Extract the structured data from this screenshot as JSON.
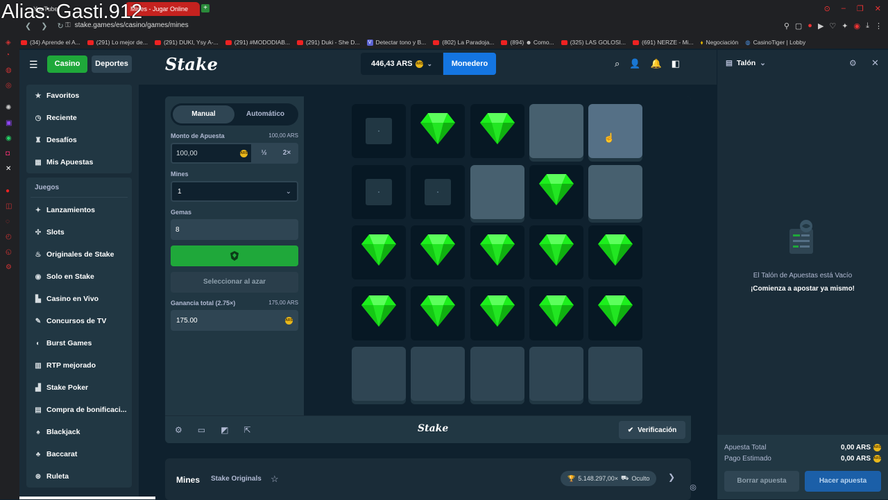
{
  "overlay": {
    "watermark": "Alias: Gasti.912"
  },
  "browser": {
    "tabs": [
      {
        "label": "YouTube"
      },
      {
        "label": "Mines - Jugar Online"
      }
    ],
    "url": "stake.games/es/casino/games/mines",
    "bookmarks": [
      {
        "label": "(34) Aprende el A...",
        "icon": "youtube-icon"
      },
      {
        "label": "(291) Lo mejor de...",
        "icon": "youtube-icon"
      },
      {
        "label": "(291) DUKI, Ysy A-...",
        "icon": "youtube-icon"
      },
      {
        "label": "(291) #MODODIAB...",
        "icon": "youtube-icon"
      },
      {
        "label": "(291) Duki - She D...",
        "icon": "youtube-icon"
      },
      {
        "label": "Detectar tono y B...",
        "icon": "v-icon"
      },
      {
        "label": "(802) La Paradoja...",
        "icon": "youtube-icon"
      },
      {
        "label": "(894) ☻ Como...",
        "icon": "youtube-icon"
      },
      {
        "label": "(325) LAS GOLOSI...",
        "icon": "youtube-icon"
      },
      {
        "label": "(691) NERZE - Mi...",
        "icon": "youtube-icon"
      },
      {
        "label": "Negociación",
        "icon": "coin-icon"
      },
      {
        "label": "CasinoTiger | Lobby",
        "icon": "globe-icon"
      }
    ]
  },
  "header": {
    "casino_label": "Casino",
    "sports_label": "Deportes",
    "logo": "Stake",
    "balance": "446,43 ARS",
    "currency_badge": "ARS",
    "wallet_label": "Monedero"
  },
  "sidebar": {
    "top_items": [
      {
        "label": "Favoritos",
        "icon": "star-icon"
      },
      {
        "label": "Reciente",
        "icon": "clock-icon"
      },
      {
        "label": "Desafíos",
        "icon": "trophy-icon"
      },
      {
        "label": "Mis Apuestas",
        "icon": "list-icon"
      }
    ],
    "games_heading": "Juegos",
    "game_items": [
      {
        "label": "Lanzamientos",
        "icon": "sparkle-icon"
      },
      {
        "label": "Slots",
        "icon": "slots-icon"
      },
      {
        "label": "Originales de Stake",
        "icon": "fire-icon"
      },
      {
        "label": "Solo en Stake",
        "icon": "chip-icon"
      },
      {
        "label": "Casino en Vivo",
        "icon": "live-icon"
      },
      {
        "label": "Concursos de TV",
        "icon": "tv-icon"
      },
      {
        "label": "Burst Games",
        "icon": "burst-icon"
      },
      {
        "label": "RTP mejorado",
        "icon": "rtp-icon"
      },
      {
        "label": "Stake Poker",
        "icon": "poker-icon"
      },
      {
        "label": "Compra de bonificaci...",
        "icon": "gift-icon"
      },
      {
        "label": "Blackjack",
        "icon": "cards-icon"
      },
      {
        "label": "Baccarat",
        "icon": "baccarat-icon"
      },
      {
        "label": "Ruleta",
        "icon": "roulette-icon"
      }
    ]
  },
  "game": {
    "mode_manual": "Manual",
    "mode_auto": "Automático",
    "bet_label": "Monto de Apuesta",
    "bet_aside": "100,00 ARS",
    "bet_value": "100,00",
    "half_label": "½",
    "double_label": "2×",
    "mines_label": "Mines",
    "mines_value": "1",
    "gems_label": "Gemas",
    "gems_value": "8",
    "random_label": "Seleccionar al azar",
    "profit_label": "Ganancia total (2.75×)",
    "profit_aside": "175,00 ARS",
    "profit_value": "175.00",
    "board": [
      [
        "empty",
        "gem",
        "gem",
        "hover2",
        "hover"
      ],
      [
        "empty",
        "empty",
        "hover2",
        "gem",
        "hover2"
      ],
      [
        "gem",
        "gem",
        "gem",
        "gem",
        "gem"
      ],
      [
        "gem",
        "gem",
        "gem",
        "gem",
        "gem"
      ],
      [
        "hidden",
        "hidden",
        "hidden",
        "hidden",
        "hidden"
      ]
    ],
    "footer_logo": "Stake",
    "verify_label": "Verificación"
  },
  "info_bar": {
    "title": "Mines",
    "subtitle": "Stake Originals",
    "badge": "5.148.297,00×",
    "badge_suffix": "Oculto"
  },
  "betslip": {
    "title": "Talón",
    "empty_line1": "El Talón de Apuestas está Vacío",
    "empty_line2": "¡Comienza a apostar ya mismo!",
    "total_label": "Apuesta Total",
    "total_value": "0,00 ARS",
    "payout_label": "Pago Estimado",
    "payout_value": "0,00 ARS",
    "clear_label": "Borrar apuesta",
    "place_label": "Hacer apuesta"
  },
  "colors": {
    "accent_green": "#1fa83a",
    "accent_blue": "#1475e1",
    "gem_green": "#1cf01c",
    "bg_dark": "#0f212e"
  }
}
